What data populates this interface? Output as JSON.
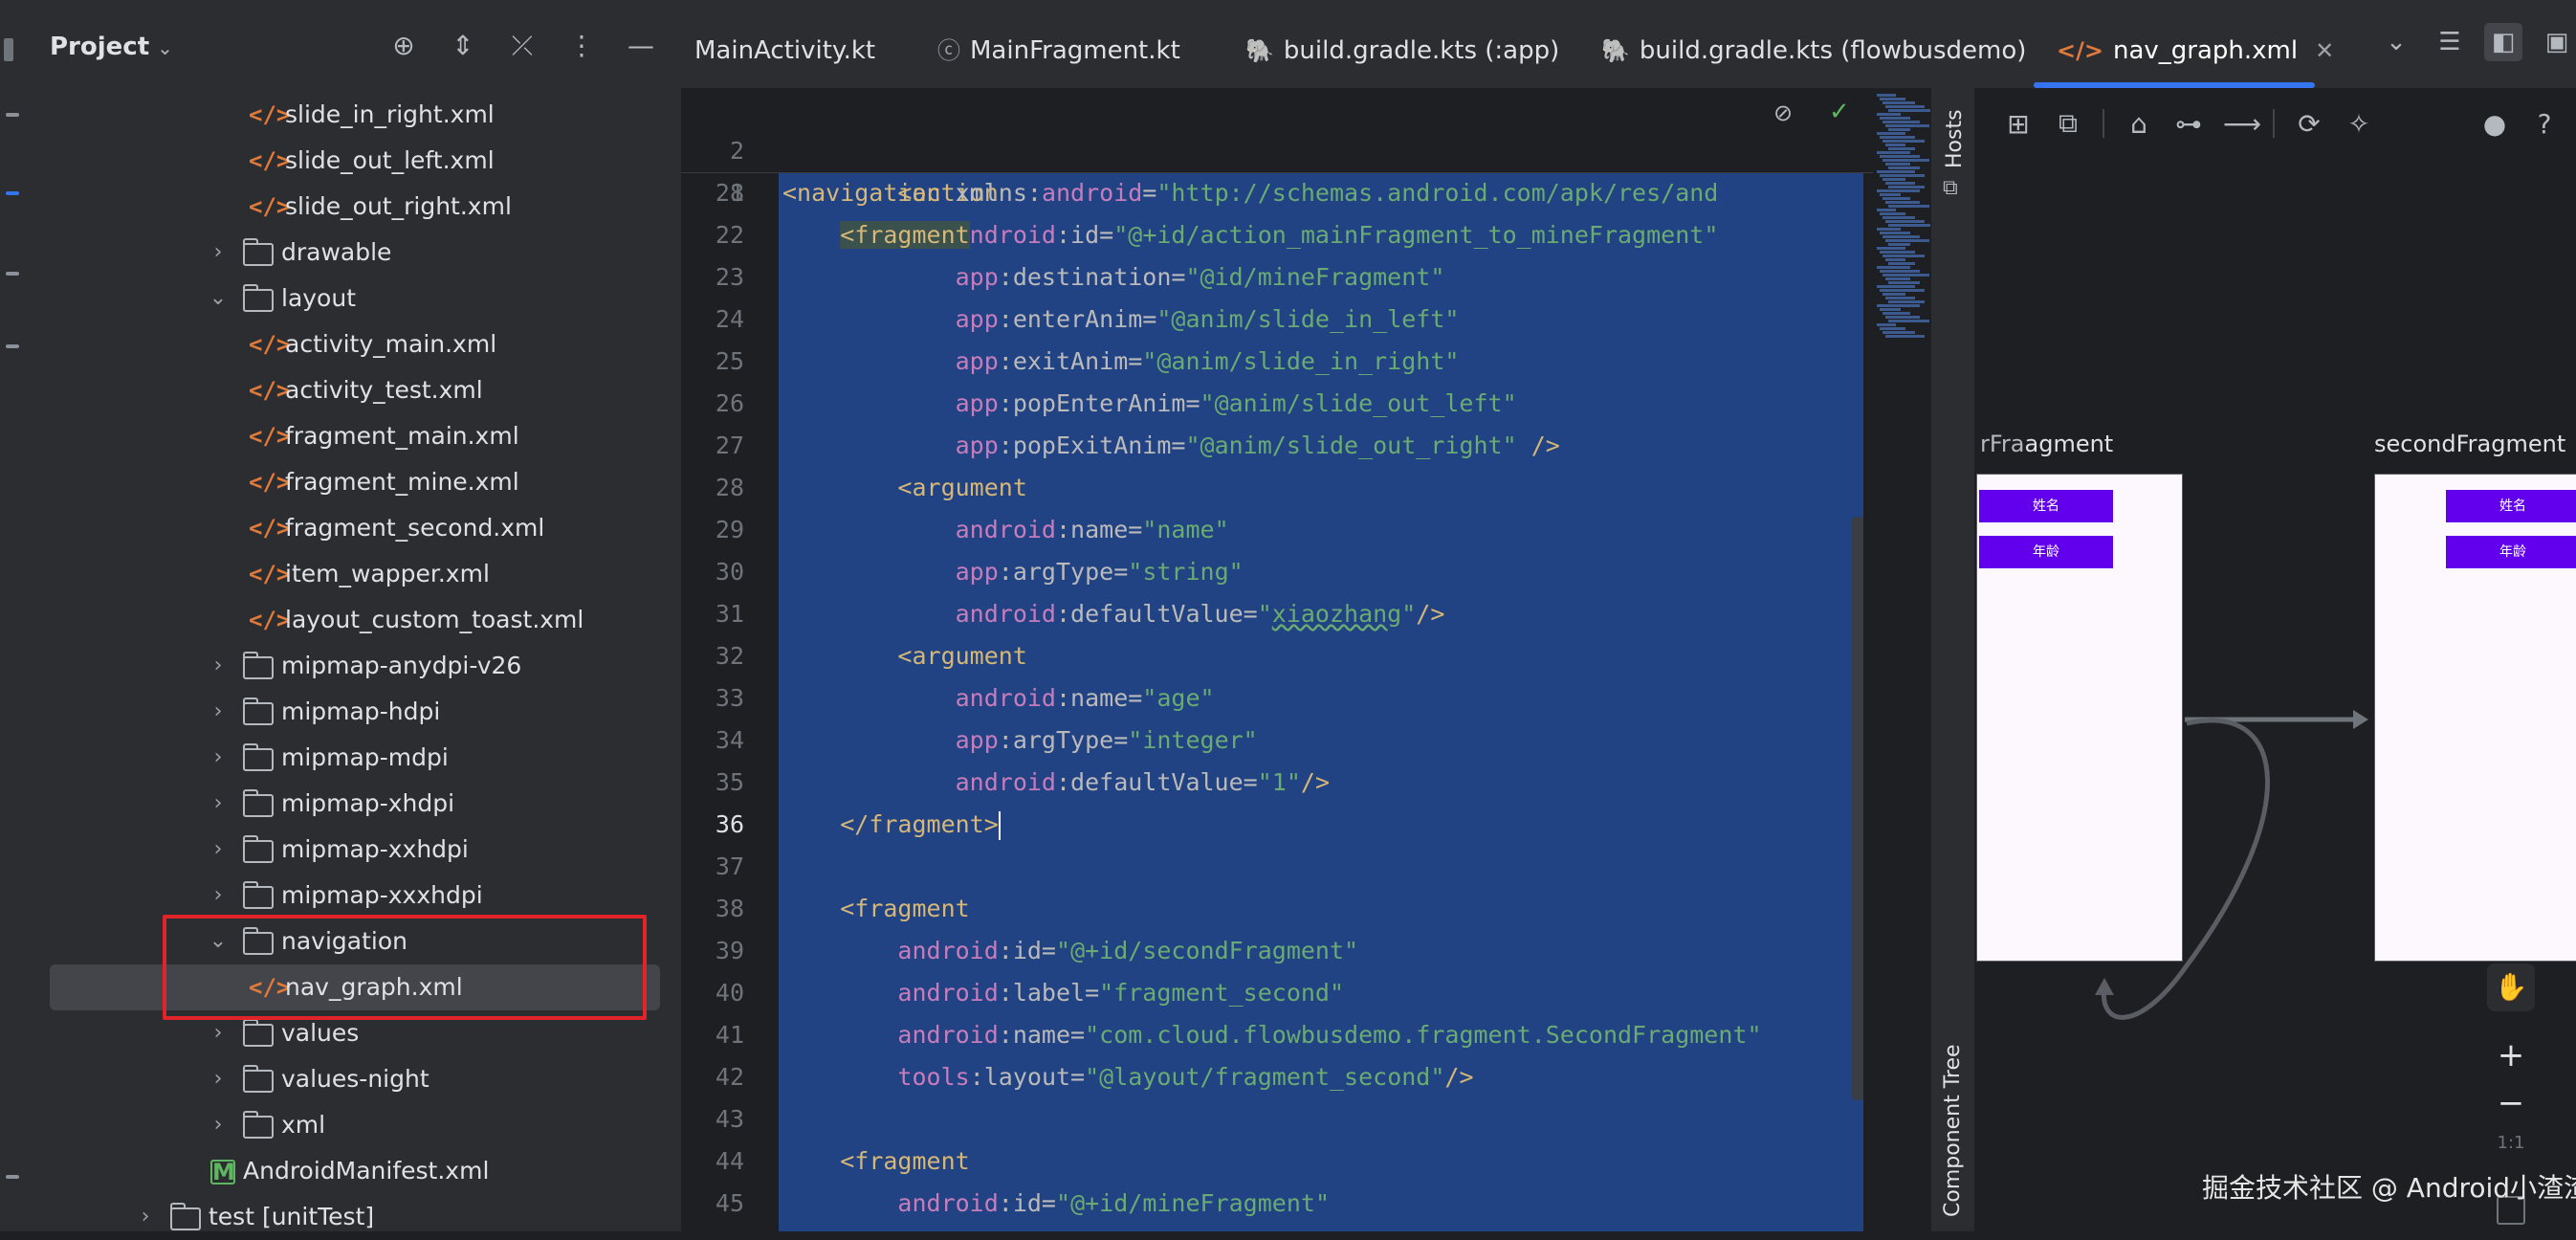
{
  "project_panel": {
    "title": "Project",
    "tree": [
      {
        "label": "slide_in_right.xml",
        "type": "xml",
        "depth": 3
      },
      {
        "label": "slide_out_left.xml",
        "type": "xml",
        "depth": 3
      },
      {
        "label": "slide_out_right.xml",
        "type": "xml",
        "depth": 3
      },
      {
        "label": "drawable",
        "type": "folder",
        "depth": 2,
        "expanded": false
      },
      {
        "label": "layout",
        "type": "folder",
        "depth": 2,
        "expanded": true
      },
      {
        "label": "activity_main.xml",
        "type": "xml",
        "depth": 3
      },
      {
        "label": "activity_test.xml",
        "type": "xml",
        "depth": 3
      },
      {
        "label": "fragment_main.xml",
        "type": "xml",
        "depth": 3
      },
      {
        "label": "fragment_mine.xml",
        "type": "xml",
        "depth": 3
      },
      {
        "label": "fragment_second.xml",
        "type": "xml",
        "depth": 3
      },
      {
        "label": "item_wapper.xml",
        "type": "xml",
        "depth": 3
      },
      {
        "label": "layout_custom_toast.xml",
        "type": "xml",
        "depth": 3
      },
      {
        "label": "mipmap-anydpi-v26",
        "type": "folder",
        "depth": 2,
        "expanded": false
      },
      {
        "label": "mipmap-hdpi",
        "type": "folder",
        "depth": 2,
        "expanded": false
      },
      {
        "label": "mipmap-mdpi",
        "type": "folder",
        "depth": 2,
        "expanded": false
      },
      {
        "label": "mipmap-xhdpi",
        "type": "folder",
        "depth": 2,
        "expanded": false
      },
      {
        "label": "mipmap-xxhdpi",
        "type": "folder",
        "depth": 2,
        "expanded": false
      },
      {
        "label": "mipmap-xxxhdpi",
        "type": "folder",
        "depth": 2,
        "expanded": false
      },
      {
        "label": "navigation",
        "type": "folder",
        "depth": 2,
        "expanded": true
      },
      {
        "label": "nav_graph.xml",
        "type": "xml",
        "depth": 3,
        "selected": true
      },
      {
        "label": "values",
        "type": "folder",
        "depth": 2,
        "expanded": false
      },
      {
        "label": "values-night",
        "type": "folder",
        "depth": 2,
        "expanded": false
      },
      {
        "label": "xml",
        "type": "folder",
        "depth": 2,
        "expanded": false
      },
      {
        "label": "AndroidManifest.xml",
        "type": "manifest",
        "depth": 1
      },
      {
        "label": "test [unitTest]",
        "type": "module",
        "depth": 0,
        "expanded": false
      }
    ]
  },
  "tabs": [
    {
      "label": "MainActivity.kt",
      "icon": "kotlin-file-icon"
    },
    {
      "label": "MainFragment.kt",
      "icon": "kotlin-class-icon"
    },
    {
      "label": "build.gradle.kts (:app)",
      "icon": "gradle-icon"
    },
    {
      "label": "build.gradle.kts (flowbusdemo)",
      "icon": "gradle-icon"
    },
    {
      "label": "nav_graph.xml",
      "icon": "xml-file-icon",
      "active": true
    }
  ],
  "editor": {
    "sticky": [
      {
        "n": "2",
        "text": "<navigation xmlns:android=\"http://schemas.android.com/apk/res/and"
      },
      {
        "n": "8",
        "text": "    <fragment"
      }
    ],
    "lines": [
      {
        "n": "21",
        "indent": 2,
        "tag": "<action"
      },
      {
        "n": "22",
        "indent": 3,
        "ns": "android",
        "attr": "id",
        "val": "@+id/action_mainFragment_to_mineFragment"
      },
      {
        "n": "23",
        "indent": 3,
        "ns": "app",
        "attr": "destination",
        "val": "@id/mineFragment"
      },
      {
        "n": "24",
        "indent": 3,
        "ns": "app",
        "attr": "enterAnim",
        "val": "@anim/slide_in_left"
      },
      {
        "n": "25",
        "indent": 3,
        "ns": "app",
        "attr": "exitAnim",
        "val": "@anim/slide_in_right"
      },
      {
        "n": "26",
        "indent": 3,
        "ns": "app",
        "attr": "popEnterAnim",
        "val": "@anim/slide_out_left"
      },
      {
        "n": "27",
        "indent": 3,
        "ns": "app",
        "attr": "popExitAnim",
        "val": "@anim/slide_out_right",
        "tail": " />"
      },
      {
        "n": "28",
        "indent": 2,
        "tag": "<argument"
      },
      {
        "n": "29",
        "indent": 3,
        "ns": "android",
        "attr": "name",
        "val": "name"
      },
      {
        "n": "30",
        "indent": 3,
        "ns": "app",
        "attr": "argType",
        "val": "string"
      },
      {
        "n": "31",
        "indent": 3,
        "ns": "android",
        "attr": "defaultValue",
        "val": "xiaozhang",
        "tail": "/>",
        "squiggle": true
      },
      {
        "n": "32",
        "indent": 2,
        "tag": "<argument"
      },
      {
        "n": "33",
        "indent": 3,
        "ns": "android",
        "attr": "name",
        "val": "age"
      },
      {
        "n": "34",
        "indent": 3,
        "ns": "app",
        "attr": "argType",
        "val": "integer"
      },
      {
        "n": "35",
        "indent": 3,
        "ns": "android",
        "attr": "defaultValue",
        "val": "1",
        "tail": "/>"
      },
      {
        "n": "36",
        "indent": 1,
        "tag": "</fragment>",
        "current": true
      },
      {
        "n": "37",
        "indent": 0,
        "tag": ""
      },
      {
        "n": "38",
        "indent": 1,
        "tag": "<fragment"
      },
      {
        "n": "39",
        "indent": 2,
        "ns": "android",
        "attr": "id",
        "val": "@+id/secondFragment"
      },
      {
        "n": "40",
        "indent": 2,
        "ns": "android",
        "attr": "label",
        "val": "fragment_second"
      },
      {
        "n": "41",
        "indent": 2,
        "ns": "android",
        "attr": "name",
        "val": "com.cloud.flowbusdemo.fragment.SecondFragment"
      },
      {
        "n": "42",
        "indent": 2,
        "ns": "tools",
        "attr": "layout",
        "val": "@layout/fragment_second",
        "tail": "/>"
      },
      {
        "n": "43",
        "indent": 0,
        "tag": ""
      },
      {
        "n": "44",
        "indent": 1,
        "tag": "<fragment"
      },
      {
        "n": "45",
        "indent": 2,
        "ns": "android",
        "attr": "id",
        "val": "@+id/mineFragment"
      }
    ]
  },
  "right_strip": {
    "hosts_label": "Hosts",
    "component_tree_label": "Component Tree"
  },
  "design": {
    "left_label": "agment",
    "left_label_overlap": "rFra",
    "right_label": "secondFragment",
    "button_name": "姓名",
    "button_age": "年龄",
    "zoom_ratio": "1:1"
  },
  "watermark": "掘金技术社区 @ Android小渣渣",
  "colors": {
    "selection": "#214283",
    "accent": "#3574f0",
    "highlight_box": "#e0242a",
    "purple_button": "#6200ee"
  }
}
